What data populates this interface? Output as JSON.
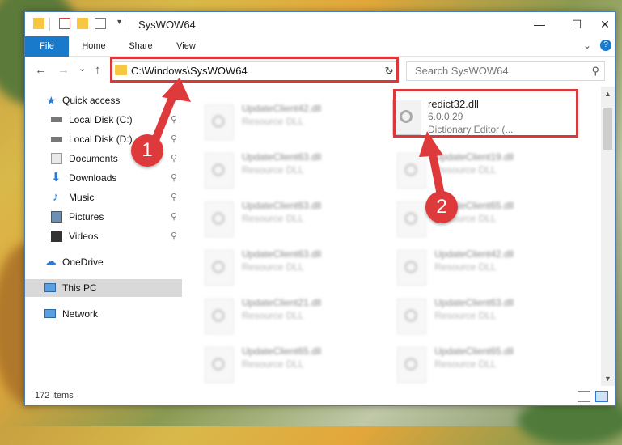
{
  "window": {
    "title": "SysWOW64",
    "controls": {
      "minimize": "—",
      "maximize": "☐",
      "close": "✕"
    }
  },
  "ribbon": {
    "tabs": [
      "File",
      "Home",
      "Share",
      "View"
    ],
    "help_icon": "?",
    "expand_icon": "chevron-down-icon"
  },
  "nav": {
    "back_icon": "←",
    "forward_icon": "→",
    "recent_icon": "⌄",
    "up_icon": "↑",
    "address": "C:\\Windows\\SysWOW64",
    "search_placeholder": "Search SysWOW64"
  },
  "sidebar": {
    "items": [
      {
        "label": "Quick access",
        "icon": "star-icon",
        "pinned": false
      },
      {
        "label": "Local Disk (C:)",
        "icon": "drive-icon",
        "pinned": true
      },
      {
        "label": "Local Disk (D:)",
        "icon": "drive-icon",
        "pinned": true
      },
      {
        "label": "Documents",
        "icon": "documents-icon",
        "pinned": true
      },
      {
        "label": "Downloads",
        "icon": "download-icon",
        "pinned": true
      },
      {
        "label": "Music",
        "icon": "music-icon",
        "pinned": true
      },
      {
        "label": "Pictures",
        "icon": "pictures-icon",
        "pinned": true
      },
      {
        "label": "Videos",
        "icon": "videos-icon",
        "pinned": true
      },
      {
        "label": "OneDrive",
        "icon": "cloud-icon",
        "pinned": false
      },
      {
        "label": "This PC",
        "icon": "computer-icon",
        "pinned": false,
        "selected": true
      },
      {
        "label": "Network",
        "icon": "network-icon",
        "pinned": false
      }
    ],
    "pin_glyph": "📌"
  },
  "files": {
    "highlighted": {
      "name": "redict32.dll",
      "version": "6.0.0.29",
      "description": "Dictionary Editor (..."
    },
    "left_column": [
      {
        "name": "UpdateClient42.dll",
        "type": "Resource DLL"
      },
      {
        "name": "UpdateClient63.dll",
        "type": "Resource DLL"
      },
      {
        "name": "UpdateClient63.dll",
        "type": "Resource DLL"
      },
      {
        "name": "UpdateClient63.dll",
        "type": "Resource DLL"
      },
      {
        "name": "UpdateClient21.dll",
        "type": "Resource DLL"
      },
      {
        "name": "UpdateClient65.dll",
        "type": "Resource DLL"
      }
    ],
    "right_column": [
      {
        "name": "UpdateClient19.dll",
        "type": "Resource DLL"
      },
      {
        "name": "UpdateClient65.dll",
        "type": "Resource DLL"
      },
      {
        "name": "UpdateClient42.dll",
        "type": "Resource DLL"
      },
      {
        "name": "UpdateClient63.dll",
        "type": "Resource DLL"
      },
      {
        "name": "UpdateClient65.dll",
        "type": "Resource DLL"
      }
    ]
  },
  "status": {
    "item_count": "172 items"
  },
  "annotations": {
    "callout_1": "1",
    "callout_2": "2",
    "color": "#de3a3c"
  }
}
